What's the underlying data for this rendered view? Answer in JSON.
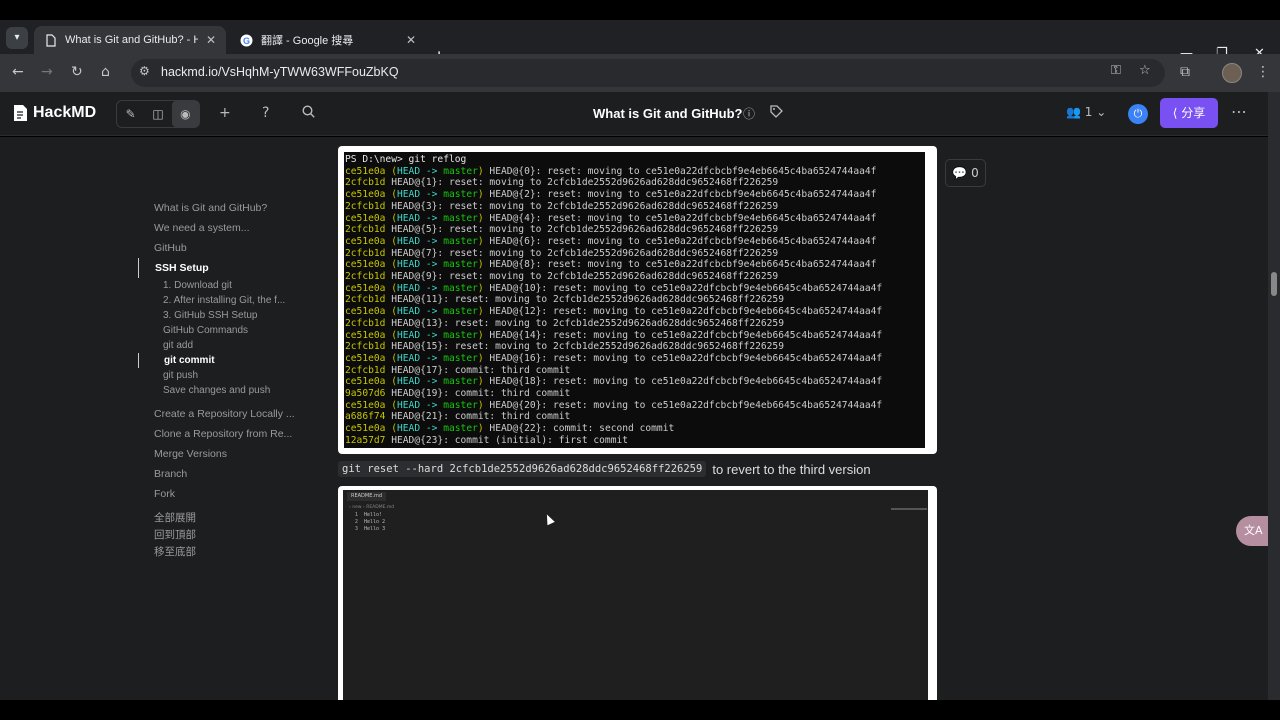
{
  "browser": {
    "tabs": [
      {
        "title": "What is Git and GitHub? - Hac",
        "favicon": "document-icon"
      },
      {
        "title": "翻譯 - Google 搜尋",
        "favicon": "google-icon"
      }
    ],
    "url": "hackmd.io/VsHqhM-yTWW63WFFouZbKQ"
  },
  "hackmd": {
    "logo": "HackMD",
    "title": "What is Git and GitHub?",
    "online_count": "1",
    "share_label": "分享",
    "comment_count": "0"
  },
  "toc": {
    "items": [
      {
        "label": "What is Git and GitHub?"
      },
      {
        "label": "We need a system..."
      },
      {
        "label": "GitHub"
      },
      {
        "label": "SSH Setup"
      },
      {
        "label": "1. Download git"
      },
      {
        "label": "2. After installing Git, the f..."
      },
      {
        "label": "3. GitHub SSH Setup"
      },
      {
        "label": "GitHub Commands"
      },
      {
        "label": "git add"
      },
      {
        "label": "git commit"
      },
      {
        "label": "git push"
      },
      {
        "label": "Save changes and push"
      },
      {
        "label": "Create a Repository Locally ..."
      },
      {
        "label": "Clone a Repository from Re..."
      },
      {
        "label": "Merge Versions"
      },
      {
        "label": "Branch"
      },
      {
        "label": "Fork"
      }
    ],
    "expand_all": "全部展開",
    "back_to_top": "回到頂部",
    "go_to_bottom": "移至底部"
  },
  "terminal": {
    "prompt": "PS D:\\new> git reflog",
    "lines": [
      {
        "hash": "ce51e0a",
        "head": true,
        "rest": " HEAD@{0}: reset: moving to ce51e0a22dfcbcbf9e4eb6645c4ba6524744aa4f"
      },
      {
        "hash": "2cfcb1d",
        "head": false,
        "rest": " HEAD@{1}: reset: moving to 2cfcb1de2552d9626ad628ddc9652468ff226259"
      },
      {
        "hash": "ce51e0a",
        "head": true,
        "rest": " HEAD@{2}: reset: moving to ce51e0a22dfcbcbf9e4eb6645c4ba6524744aa4f"
      },
      {
        "hash": "2cfcb1d",
        "head": false,
        "rest": " HEAD@{3}: reset: moving to 2cfcb1de2552d9626ad628ddc9652468ff226259"
      },
      {
        "hash": "ce51e0a",
        "head": true,
        "rest": " HEAD@{4}: reset: moving to ce51e0a22dfcbcbf9e4eb6645c4ba6524744aa4f"
      },
      {
        "hash": "2cfcb1d",
        "head": false,
        "rest": " HEAD@{5}: reset: moving to 2cfcb1de2552d9626ad628ddc9652468ff226259"
      },
      {
        "hash": "ce51e0a",
        "head": true,
        "rest": " HEAD@{6}: reset: moving to ce51e0a22dfcbcbf9e4eb6645c4ba6524744aa4f"
      },
      {
        "hash": "2cfcb1d",
        "head": false,
        "rest": " HEAD@{7}: reset: moving to 2cfcb1de2552d9626ad628ddc9652468ff226259"
      },
      {
        "hash": "ce51e0a",
        "head": true,
        "rest": " HEAD@{8}: reset: moving to ce51e0a22dfcbcbf9e4eb6645c4ba6524744aa4f"
      },
      {
        "hash": "2cfcb1d",
        "head": false,
        "rest": " HEAD@{9}: reset: moving to 2cfcb1de2552d9626ad628ddc9652468ff226259"
      },
      {
        "hash": "ce51e0a",
        "head": true,
        "rest": " HEAD@{10}: reset: moving to ce51e0a22dfcbcbf9e4eb6645c4ba6524744aa4f"
      },
      {
        "hash": "2cfcb1d",
        "head": false,
        "rest": " HEAD@{11}: reset: moving to 2cfcb1de2552d9626ad628ddc9652468ff226259"
      },
      {
        "hash": "ce51e0a",
        "head": true,
        "rest": " HEAD@{12}: reset: moving to ce51e0a22dfcbcbf9e4eb6645c4ba6524744aa4f"
      },
      {
        "hash": "2cfcb1d",
        "head": false,
        "rest": " HEAD@{13}: reset: moving to 2cfcb1de2552d9626ad628ddc9652468ff226259"
      },
      {
        "hash": "ce51e0a",
        "head": true,
        "rest": " HEAD@{14}: reset: moving to ce51e0a22dfcbcbf9e4eb6645c4ba6524744aa4f"
      },
      {
        "hash": "2cfcb1d",
        "head": false,
        "rest": " HEAD@{15}: reset: moving to 2cfcb1de2552d9626ad628ddc9652468ff226259"
      },
      {
        "hash": "ce51e0a",
        "head": true,
        "rest": " HEAD@{16}: reset: moving to ce51e0a22dfcbcbf9e4eb6645c4ba6524744aa4f"
      },
      {
        "hash": "2cfcb1d",
        "head": false,
        "rest": " HEAD@{17}: commit: third commit"
      },
      {
        "hash": "ce51e0a",
        "head": true,
        "rest": " HEAD@{18}: reset: moving to ce51e0a22dfcbcbf9e4eb6645c4ba6524744aa4f"
      },
      {
        "hash": "9a507d6",
        "head": false,
        "rest": " HEAD@{19}: commit: third commit"
      },
      {
        "hash": "ce51e0a",
        "head": true,
        "rest": " HEAD@{20}: reset: moving to ce51e0a22dfcbcbf9e4eb6645c4ba6524744aa4f"
      },
      {
        "hash": "a686f74",
        "head": false,
        "rest": " HEAD@{21}: commit: third commit"
      },
      {
        "hash": "ce51e0a",
        "head": true,
        "rest": " HEAD@{22}: commit: second commit"
      },
      {
        "hash": "12a57d7",
        "head": false,
        "rest": " HEAD@{23}: commit (initial): first commit"
      }
    ],
    "head_open": " (",
    "head_word": "HEAD -> ",
    "branch_word": "master",
    "head_close": ")"
  },
  "content": {
    "code": "git reset --hard 2cfcb1de2552d9626ad628ddc9652468ff226259",
    "after_code": "to revert to the third version"
  },
  "editor": {
    "tab": "README.md",
    "breadcrumb": "› new › README.md",
    "lines": [
      {
        "num": "1",
        "text": "Hello!"
      },
      {
        "num": "2",
        "text": "Hello 2"
      },
      {
        "num": "3",
        "text": "Hello 3"
      }
    ]
  },
  "colors": {
    "accent": "#7950f2",
    "hash_yellow": "#c6c600",
    "head_cyan": "#3ad6c8",
    "branch_green": "#16c60c"
  }
}
